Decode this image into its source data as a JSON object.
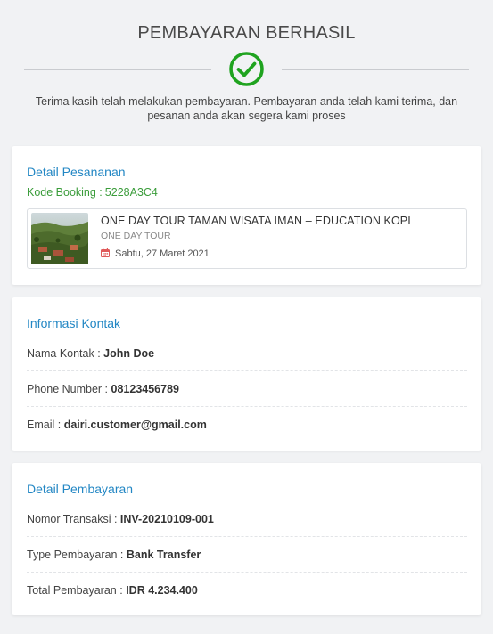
{
  "header": {
    "title": "PEMBAYARAN BERHASIL",
    "message": "Terima kasih telah melakukan pembayaran. Pembayaran anda telah kami terima, dan pesanan anda akan segera kami proses"
  },
  "order": {
    "heading": "Detail Pesananan",
    "booking_label": "Kode Booking :",
    "booking_code": "5228A3C4",
    "tour": {
      "name": "ONE DAY TOUR TAMAN WISATA IMAN – EDUCATION KOPI",
      "type": "ONE DAY TOUR",
      "date": "Sabtu, 27 Maret 2021"
    }
  },
  "contact": {
    "heading": "Informasi Kontak",
    "rows": [
      {
        "label": "Nama Kontak :",
        "value": "John Doe"
      },
      {
        "label": "Phone Number :",
        "value": "08123456789"
      },
      {
        "label": "Email :",
        "value": "dairi.customer@gmail.com"
      }
    ]
  },
  "payment": {
    "heading": "Detail Pembayaran",
    "rows": [
      {
        "label": "Nomor Transaksi :",
        "value": "INV-20210109-001"
      },
      {
        "label": "Type Pembayaran :",
        "value": "Bank Transfer"
      },
      {
        "label": "Total Pembayaran :",
        "value": "IDR 4.234.400"
      }
    ]
  },
  "icons": {
    "success": "check-circle-icon",
    "date": "calendar-icon"
  },
  "colors": {
    "success": "#1fa31f",
    "heading": "#2387c4",
    "booking": "#3a9c3a",
    "calendar": "#e05a5a"
  }
}
